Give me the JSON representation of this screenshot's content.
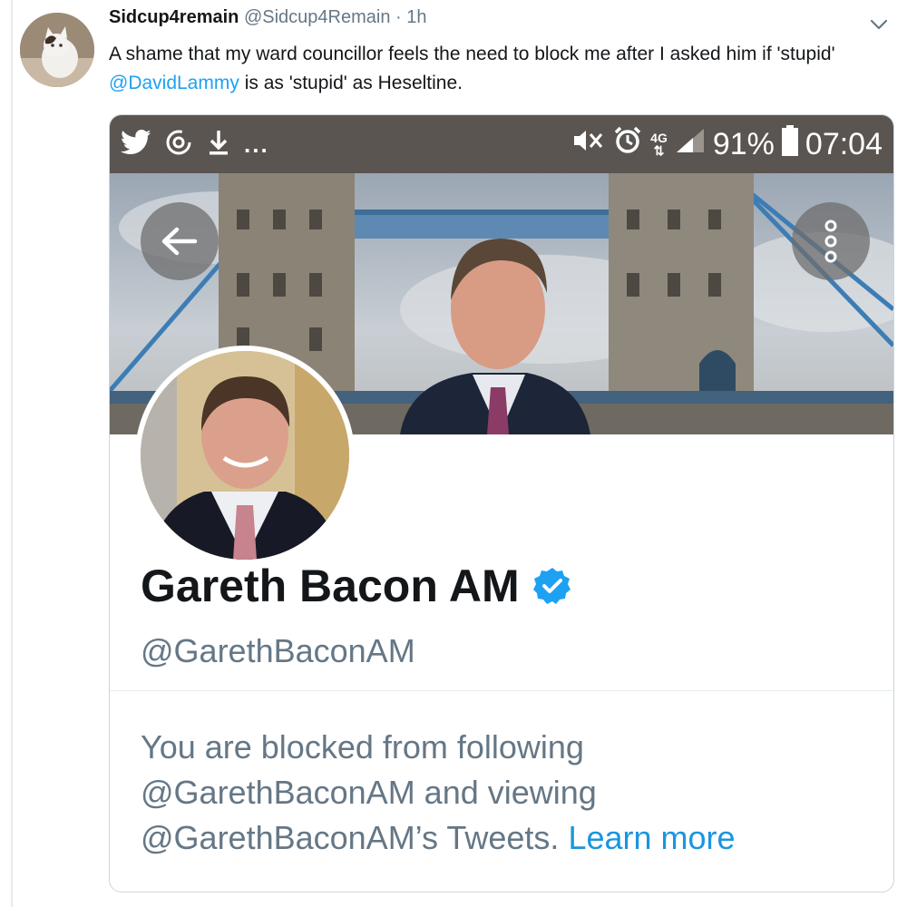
{
  "tweet": {
    "display_name": "Sidcup4remain",
    "handle": "@Sidcup4Remain",
    "separator": "·",
    "time": "1h",
    "text_part1": "A shame that my ward councillor feels the need to block me after I asked him if 'stupid' ",
    "mention": "@DavidLammy",
    "text_part2": " is as 'stupid' as Heseltine.",
    "avatar_icon": "cat-avatar",
    "menu_icon": "chevron-down-icon"
  },
  "screenshot": {
    "status_bar": {
      "left_icons": [
        "twitter-icon",
        "sync-icon",
        "download-icon"
      ],
      "left_more": "...",
      "right_icons": [
        "mute-vibrate-icon",
        "alarm-icon"
      ],
      "network": "4G",
      "battery": "91%",
      "time": "07:04"
    },
    "banner": {
      "back_icon": "arrow-left-icon",
      "more_icon": "more-vertical-icon"
    },
    "profile": {
      "name": "Gareth Bacon AM",
      "handle": "@GarethBaconAM",
      "verified_icon": "verified-badge-icon"
    },
    "blocked_message": {
      "line1": "You are blocked from following",
      "line2": "@GarethBaconAM and viewing",
      "line3": "@GarethBaconAM’s Tweets.",
      "link": "Learn more"
    }
  },
  "colors": {
    "link": "#1da1f2",
    "status_bar": "#5b5551",
    "muted": "#657786",
    "verified": "#1da1f2"
  }
}
